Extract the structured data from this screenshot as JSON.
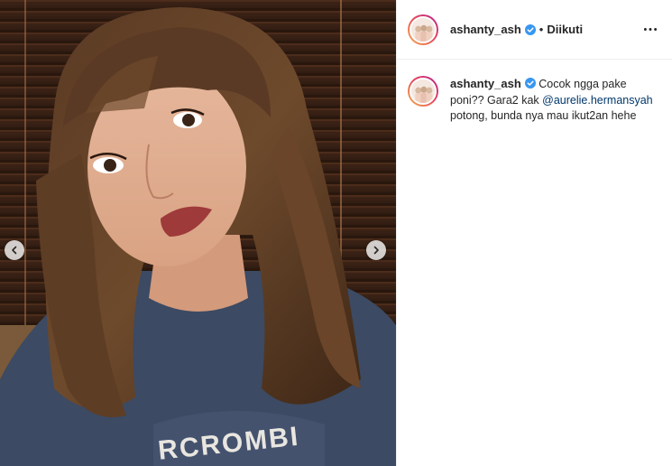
{
  "post": {
    "username": "ashanty_ash",
    "dot": "•",
    "follow_status": "Diikuti",
    "caption": {
      "username": "ashanty_ash",
      "text_before": "Cocok ngga pake poni?? Gara2 kak ",
      "mention": "@aurelie.hermansyah",
      "text_after": " potong, bunda nya mau ikut2an hehe"
    }
  },
  "icons": {
    "verified": "verified-badge-icon",
    "more": "more-options-icon",
    "prev": "chevron-left-icon",
    "next": "chevron-right-icon"
  },
  "colors": {
    "verified_blue": "#3897f0",
    "mention_blue": "#00376b",
    "text": "#262626"
  }
}
